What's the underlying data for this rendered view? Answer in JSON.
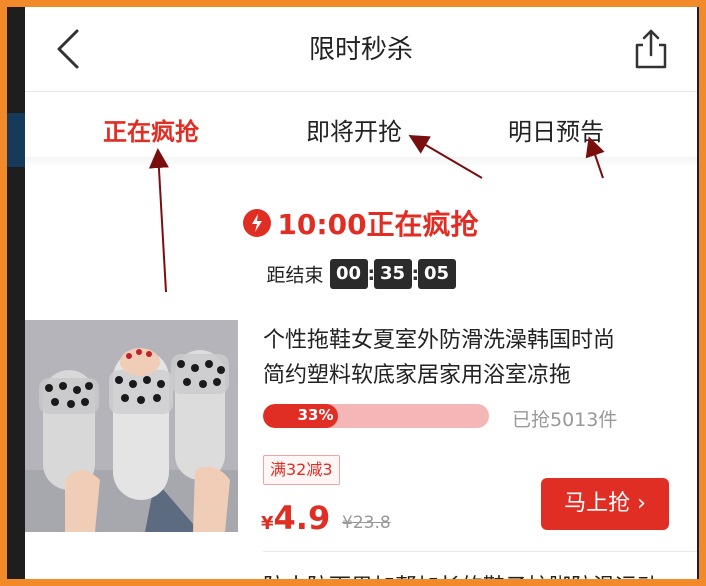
{
  "header": {
    "title": "限时秒杀"
  },
  "tabs": [
    {
      "label": "正在疯抢",
      "active": true
    },
    {
      "label": "即将开抢",
      "active": false
    },
    {
      "label": "明日预告",
      "active": false
    }
  ],
  "session": {
    "status": "10:00正在疯抢",
    "countdown_label": "距结束",
    "hours": "00",
    "minutes": "35",
    "seconds": "05"
  },
  "product": {
    "title_line1": "个性拖鞋女夏室外防滑洗澡韩国时尚",
    "title_line2": "简约塑料软底家居家用浴室凉拖",
    "progress_label": "33%",
    "progress_fraction": 0.33,
    "sold": "已抢5013件",
    "coupon": "满32减3",
    "price_symbol": "¥",
    "price": "4.9",
    "original_price": "¥23.8",
    "buy_label": "马上抢 ›"
  },
  "next_product": {
    "title_partial": "防水防雨男加帮加长的鞋子护脚防滑运动"
  },
  "colors": {
    "accent": "#e02e24",
    "frame": "#f28a2a",
    "annotation_arrow": "#7a0e0e"
  }
}
